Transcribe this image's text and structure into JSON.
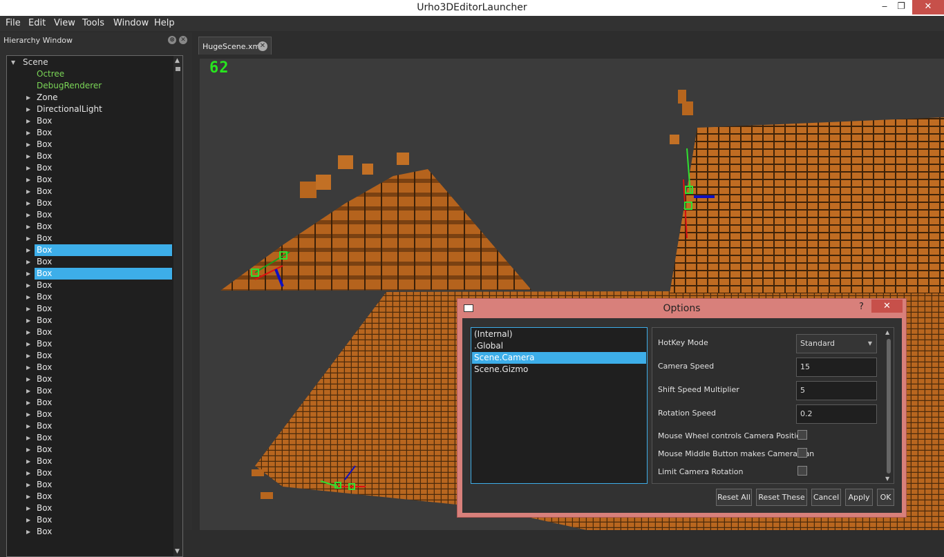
{
  "window": {
    "title": "Urho3DEditorLauncher",
    "minimize": "‒",
    "maximize": "❐",
    "close": "✕"
  },
  "menubar": [
    "File",
    "Edit",
    "View",
    "Tools",
    "Window",
    "Help"
  ],
  "hierarchy": {
    "title": "Hierarchy Window",
    "float_btn": "⊗",
    "close_btn": "✕",
    "root": "Scene",
    "items": [
      {
        "label": "Octree",
        "kind": "component"
      },
      {
        "label": "DebugRenderer",
        "kind": "component"
      },
      {
        "label": "Zone",
        "kind": "node"
      },
      {
        "label": "DirectionalLight",
        "kind": "node"
      },
      {
        "label": "Box",
        "kind": "node"
      },
      {
        "label": "Box",
        "kind": "node"
      },
      {
        "label": "Box",
        "kind": "node"
      },
      {
        "label": "Box",
        "kind": "node"
      },
      {
        "label": "Box",
        "kind": "node"
      },
      {
        "label": "Box",
        "kind": "node"
      },
      {
        "label": "Box",
        "kind": "node"
      },
      {
        "label": "Box",
        "kind": "node"
      },
      {
        "label": "Box",
        "kind": "node"
      },
      {
        "label": "Box",
        "kind": "node"
      },
      {
        "label": "Box",
        "kind": "node"
      },
      {
        "label": "Box",
        "kind": "node",
        "selected": true
      },
      {
        "label": "Box",
        "kind": "node"
      },
      {
        "label": "Box",
        "kind": "node",
        "selected": true
      },
      {
        "label": "Box",
        "kind": "node"
      },
      {
        "label": "Box",
        "kind": "node"
      },
      {
        "label": "Box",
        "kind": "node"
      },
      {
        "label": "Box",
        "kind": "node"
      },
      {
        "label": "Box",
        "kind": "node"
      },
      {
        "label": "Box",
        "kind": "node"
      },
      {
        "label": "Box",
        "kind": "node"
      },
      {
        "label": "Box",
        "kind": "node"
      },
      {
        "label": "Box",
        "kind": "node"
      },
      {
        "label": "Box",
        "kind": "node"
      },
      {
        "label": "Box",
        "kind": "node"
      },
      {
        "label": "Box",
        "kind": "node"
      },
      {
        "label": "Box",
        "kind": "node"
      },
      {
        "label": "Box",
        "kind": "node"
      },
      {
        "label": "Box",
        "kind": "node"
      },
      {
        "label": "Box",
        "kind": "node"
      },
      {
        "label": "Box",
        "kind": "node"
      },
      {
        "label": "Box",
        "kind": "node"
      },
      {
        "label": "Box",
        "kind": "node"
      },
      {
        "label": "Box",
        "kind": "node"
      },
      {
        "label": "Box",
        "kind": "node"
      },
      {
        "label": "Box",
        "kind": "node"
      }
    ]
  },
  "document_tab": {
    "label": "HugeScene.xml",
    "close": "✕"
  },
  "viewport": {
    "fps": "62"
  },
  "options": {
    "title": "Options",
    "help": "?",
    "close": "✕",
    "categories": [
      {
        "label": "(Internal)"
      },
      {
        "label": ".Global"
      },
      {
        "label": "Scene.Camera",
        "selected": true
      },
      {
        "label": "Scene.Gizmo"
      }
    ],
    "settings": {
      "hotkey_mode": {
        "label": "HotKey Mode",
        "value": "Standard"
      },
      "camera_speed": {
        "label": "Camera Speed",
        "value": "15"
      },
      "shift_speed_multiplier": {
        "label": "Shift Speed Multiplier",
        "value": "5"
      },
      "rotation_speed": {
        "label": "Rotation Speed",
        "value": "0.2"
      },
      "mouse_wheel_camera_position": {
        "label": "Mouse Wheel controls Camera Position",
        "checked": false
      },
      "mouse_middle_camera_pan": {
        "label": "Mouse Middle Button makes Camera pan",
        "checked": false
      },
      "limit_camera_rotation": {
        "label": "Limit Camera Rotation",
        "checked": false
      }
    },
    "buttons": {
      "reset_all": "Reset All",
      "reset_these": "Reset These",
      "cancel": "Cancel",
      "apply": "Apply",
      "ok": "OK"
    }
  },
  "colors": {
    "selection": "#3daee9",
    "component_text": "#7bd657",
    "box_orange": "#b8661f",
    "dialog_frame": "#d8807b",
    "fps_green": "#27e61e"
  }
}
